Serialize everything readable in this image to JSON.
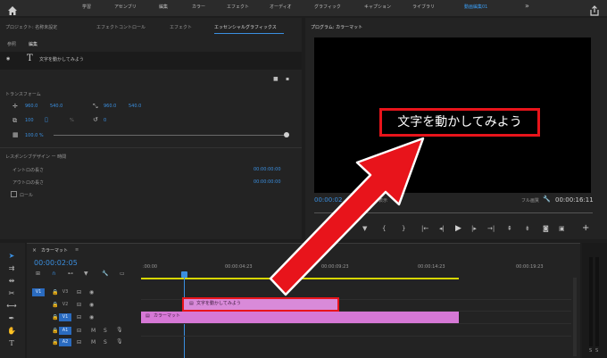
{
  "topbar": {
    "tabs": [
      "学習",
      "アセンブリ",
      "編集",
      "カラー",
      "エフェクト",
      "オーディオ",
      "グラフィック",
      "キャプション",
      "ライブラリ",
      "動画編集01"
    ],
    "active_index": 9,
    "more": "»"
  },
  "left_panel": {
    "tabs": [
      "プロジェクト: 名称未設定",
      "エフェクトコントロール",
      "エフェクト",
      "エッセンシャルグラフィックス"
    ],
    "subtabs": [
      "参照",
      "編集"
    ],
    "layer_text": "文字を動かしてみよう",
    "transform_label": "トランスフォーム",
    "pos_x": "960.0",
    "pos_y": "540.0",
    "anchor_x": "960.0",
    "anchor_y": "540.0",
    "scale": "100",
    "scale_unit": "%",
    "rotation": "0",
    "opacity": "100.0 %",
    "responsive_label": "レスポンシブデザイン ー 時間",
    "intro_label": "イントロの長さ",
    "outro_label": "アウトロの長さ",
    "intro_value": "00:00:00:00",
    "outro_value": "00:00:00:00",
    "roll_label": "ロール"
  },
  "program": {
    "title": "プログラム: カラーマット",
    "overlay_text": "文字を動かしてみよう",
    "timecode": "00:00:02",
    "fit_label": "表示",
    "quality": "フル画質",
    "duration": "00:00:16:11"
  },
  "timeline": {
    "sequence_name": "カラーマット",
    "timecode": "00:00:02:05",
    "ruler": [
      ":00:00",
      "00:00:04:23",
      "00:00:09:23",
      "00:00:14:23",
      "00:00:19:23"
    ],
    "tracks_video": [
      "V3",
      "V2",
      "V1"
    ],
    "tracks_audio": [
      "A1",
      "A2"
    ],
    "source_v1": "V1",
    "text_clip": "文字を動かしてみよう",
    "matte_clip": "カラーマット"
  },
  "meter": {
    "labels": [
      "S",
      "S"
    ]
  }
}
